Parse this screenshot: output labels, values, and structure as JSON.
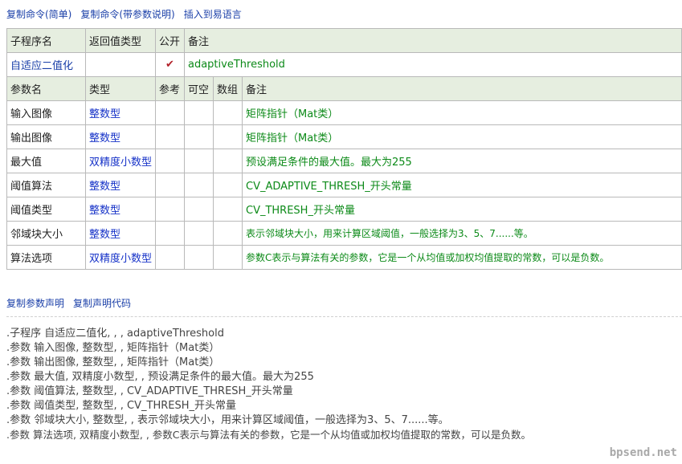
{
  "top_links": [
    "复制命令(简单)",
    "复制命令(带参数说明)",
    "插入到易语言"
  ],
  "header": {
    "col1": "子程序名",
    "col2": "返回值类型",
    "col3": "公开",
    "col4": "备注"
  },
  "subroutine": {
    "name": "自适应二值化",
    "return_type": "",
    "public_mark": "✔",
    "remark": "adaptiveThreshold"
  },
  "param_header": {
    "name": "参数名",
    "type": "类型",
    "ref": "参考",
    "optional": "可空",
    "array": "数组",
    "remark": "备注"
  },
  "params": [
    {
      "name": "输入图像",
      "type": "整数型",
      "remark": "矩阵指针（Mat类）"
    },
    {
      "name": "输出图像",
      "type": "整数型",
      "remark": "矩阵指针（Mat类）"
    },
    {
      "name": "最大值",
      "type": "双精度小数型",
      "remark": "预设满足条件的最大值。最大为255"
    },
    {
      "name": "阈值算法",
      "type": "整数型",
      "remark": "CV_ADAPTIVE_THRESH_开头常量"
    },
    {
      "name": "阈值类型",
      "type": "整数型",
      "remark": "CV_THRESH_开头常量"
    },
    {
      "name": "邻域块大小",
      "type": "整数型",
      "remark": "表示邻域块大小，用来计算区域阈值，一般选择为3、5、7......等。"
    },
    {
      "name": "算法选项",
      "type": "双精度小数型",
      "remark": "参数C表示与算法有关的参数，它是一个从均值或加权均值提取的常数，可以是负数。"
    }
  ],
  "sub_links": [
    "复制参数声明",
    "复制声明代码"
  ],
  "code_lines": [
    ".子程序 自适应二值化, , , adaptiveThreshold",
    ".参数 输入图像, 整数型, , 矩阵指针（Mat类）",
    ".参数 输出图像, 整数型, , 矩阵指针（Mat类）",
    ".参数 最大值, 双精度小数型, , 预设满足条件的最大值。最大为255",
    ".参数 阈值算法, 整数型, , CV_ADAPTIVE_THRESH_开头常量",
    ".参数 阈值类型, 整数型, , CV_THRESH_开头常量",
    ".参数 邻域块大小, 整数型, , 表示邻域块大小，用来计算区域阈值，一般选择为3、5、7......等。",
    ".参数 算法选项, 双精度小数型, , 参数C表示与算法有关的参数，它是一个从均值或加权均值提取的常数，可以是负数。"
  ],
  "watermark": "bpsend.net",
  "colors": {
    "link": "#1a3fa8",
    "type": "#1733c8",
    "remark": "#0c8a18",
    "header_bg": "#e6eee0",
    "check": "#b22028"
  }
}
